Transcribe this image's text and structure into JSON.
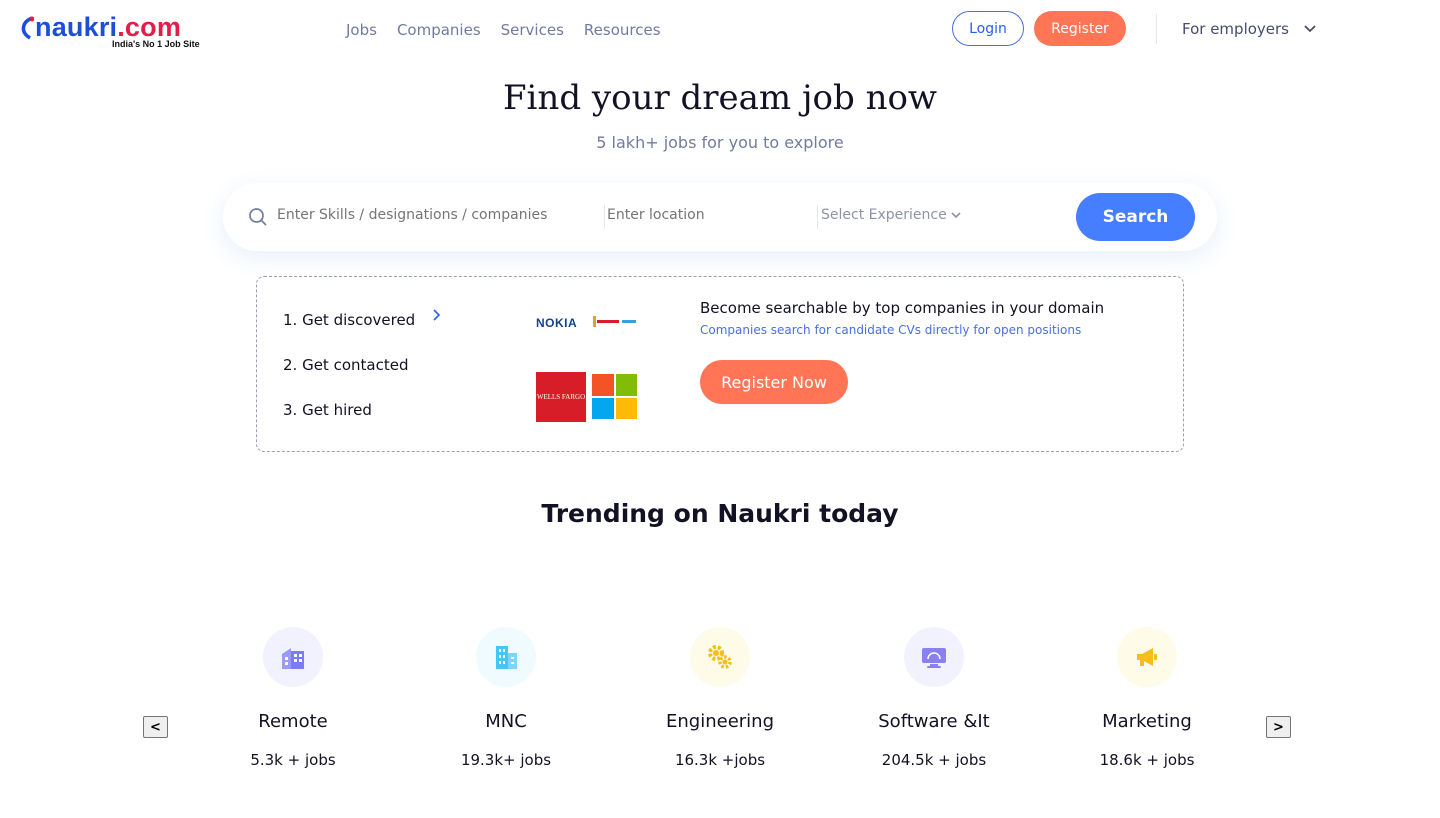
{
  "header": {
    "logo_text": "naukri",
    "logo_dot": ".com",
    "logo_tagline": "India's No 1 Job Site",
    "nav": [
      "Jobs",
      "Companies",
      "Services",
      "Resources"
    ],
    "login_label": "Login",
    "register_label": "Register",
    "employers_label": "For employers"
  },
  "hero": {
    "title": "Find your dream job now",
    "subtitle": "5 lakh+ jobs for you to explore"
  },
  "search": {
    "skills_placeholder": "Enter Skills / designations / companies",
    "location_placeholder": "Enter location",
    "experience_label": "Select Experience",
    "button_label": "Search"
  },
  "promo": {
    "steps": [
      "1. Get discovered",
      "2. Get contacted",
      "3. Get hired"
    ],
    "company_logos": [
      "NOKIA",
      "WELLS FARGO"
    ],
    "title": "Become searchable by top companies in your domain",
    "subtitle": "Companies search for candidate CVs directly for open positions",
    "button_label": "Register Now"
  },
  "trending": {
    "title": "Trending on Naukri today",
    "categories": [
      {
        "name": "Remote",
        "count": "5.3k + jobs",
        "icon": "building-icon",
        "bg": "#f2f2ff",
        "color": "#7c7cf6"
      },
      {
        "name": "MNC",
        "count": "19.3k+ jobs",
        "icon": "office-tower-icon",
        "bg": "#effbff",
        "color": "#45c6f5"
      },
      {
        "name": "Engineering",
        "count": "16.3k +jobs",
        "icon": "gears-icon",
        "bg": "#fffbe9",
        "color": "#f7bd1b"
      },
      {
        "name": "Software &It",
        "count": "204.5k + jobs",
        "icon": "monitor-icon",
        "bg": "#f2f2ff",
        "color": "#8b80f0"
      },
      {
        "name": "Marketing",
        "count": "18.6k + jobs",
        "icon": "megaphone-icon",
        "bg": "#fffbe9",
        "color": "#f7bd1b"
      }
    ],
    "prev_label": "<",
    "next_label": ">"
  },
  "colors": {
    "accent_blue": "#457eff",
    "accent_orange": "#ff7555",
    "text_dark": "#121224",
    "text_muted": "#717b9e"
  }
}
